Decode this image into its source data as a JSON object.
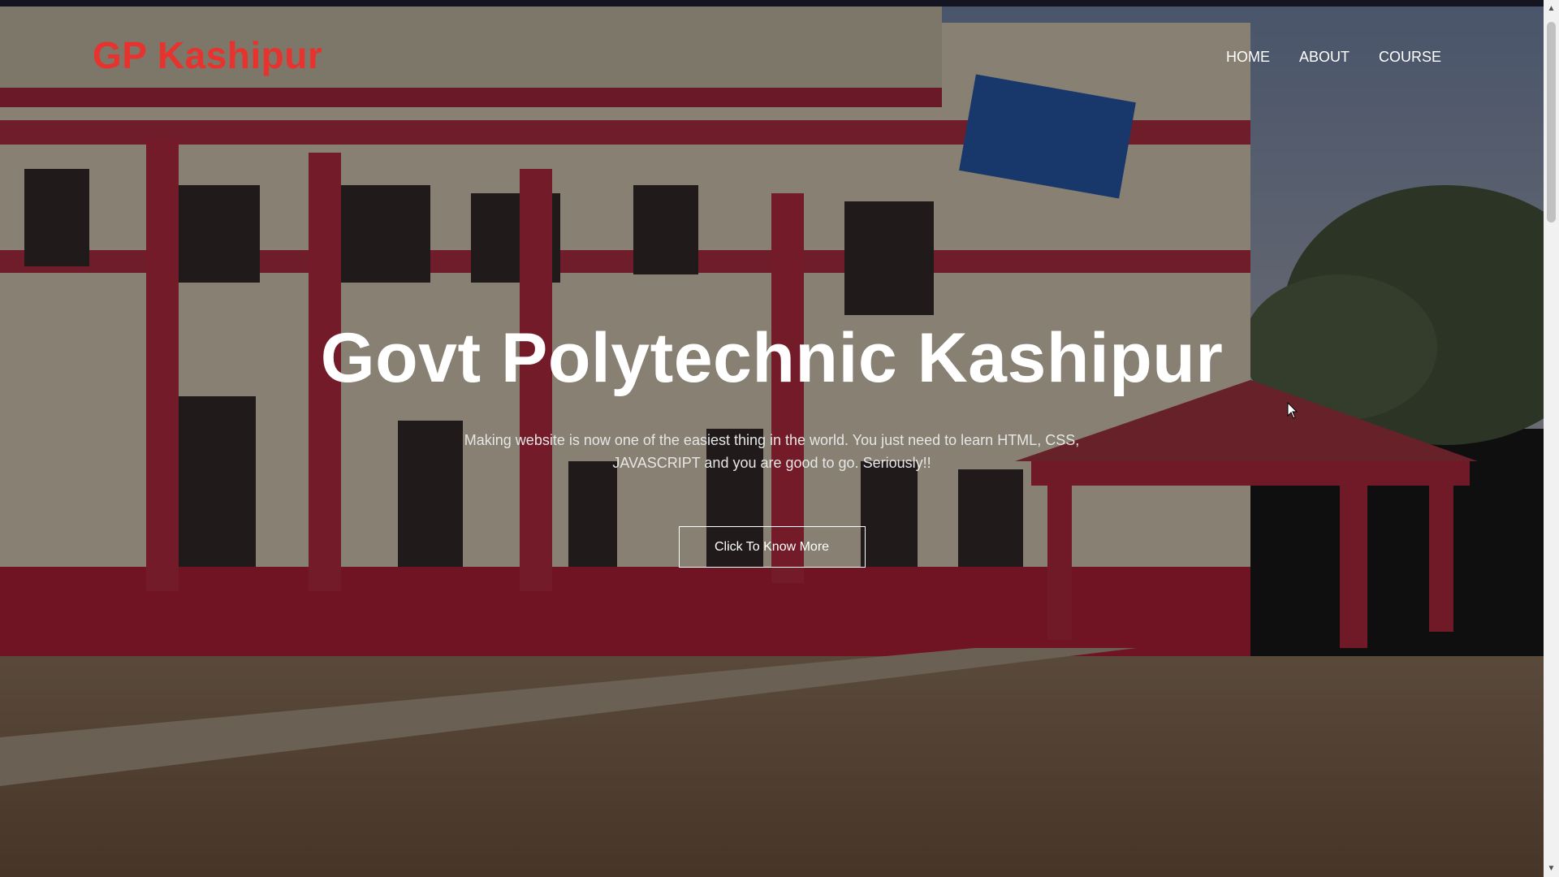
{
  "navbar": {
    "logo": "GP Kashipur",
    "links": [
      "HOME",
      "ABOUT",
      "COURSE"
    ]
  },
  "hero": {
    "title": "Govt Polytechnic Kashipur",
    "description": "Making website is now one of the easiest thing in the world. You just need to learn HTML, CSS, JAVASCRIPT and you are good to go. Seriously!!",
    "button_label": "Click To Know More",
    "background_image": "college-building-photo"
  },
  "colors": {
    "logo": "#e8322e",
    "text": "#ffffff",
    "overlay": "rgba(0,0,0,0.42)"
  },
  "icons": {
    "scroll_up": "chevron-up-icon",
    "scroll_down": "chevron-down-icon",
    "cursor": "mouse-pointer-icon"
  }
}
